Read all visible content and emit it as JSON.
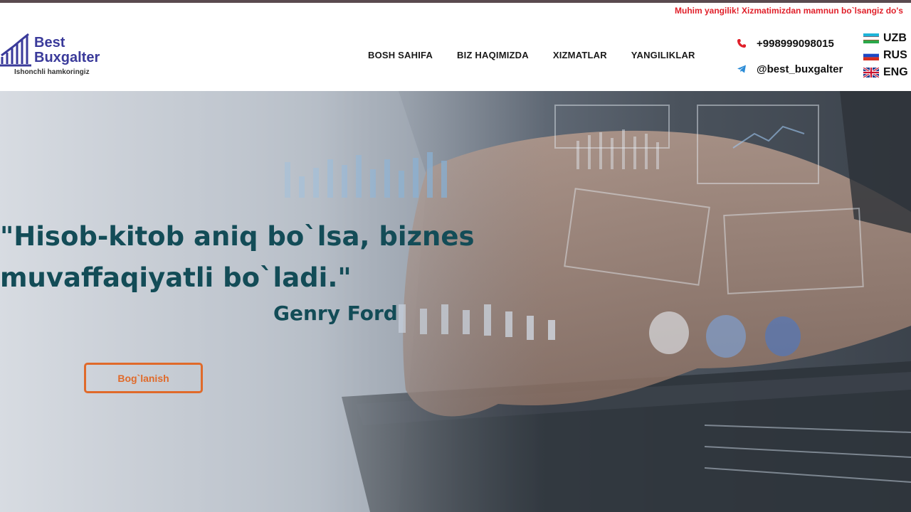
{
  "ticker": {
    "text": "Muhim yangilik! Xizmatimizdan mamnun bo`lsangiz do's"
  },
  "logo": {
    "name_line1": "Best",
    "name_line2": "Buxgalter",
    "tagline": "Ishonchli hamkoringiz"
  },
  "nav": {
    "items": [
      {
        "label": "BOSH SAHIFA"
      },
      {
        "label": "BIZ HAQIMIZDA"
      },
      {
        "label": "XIZMATLAR"
      },
      {
        "label": "YANGILIKLAR"
      }
    ]
  },
  "contacts": {
    "phone": "+998999098015",
    "telegram": "@best_buxgalter"
  },
  "languages": [
    {
      "code": "UZB",
      "flag_icon": "uzbekistan-flag-icon"
    },
    {
      "code": "RUS",
      "flag_icon": "russia-flag-icon"
    },
    {
      "code": "ENG",
      "flag_icon": "uk-flag-icon"
    }
  ],
  "hero": {
    "quote_line1": "\"Hisob-kitob aniq bo`lsa, biznes",
    "quote_line2": "muvaffaqiyatli bo`ladi.\"",
    "author": "Genry Ford",
    "cta_label": "Bog`lanish"
  },
  "colors": {
    "accent": "#e06a2a",
    "quote": "#134c57",
    "brand": "#3a3a9a",
    "ticker": "#e0202a"
  }
}
